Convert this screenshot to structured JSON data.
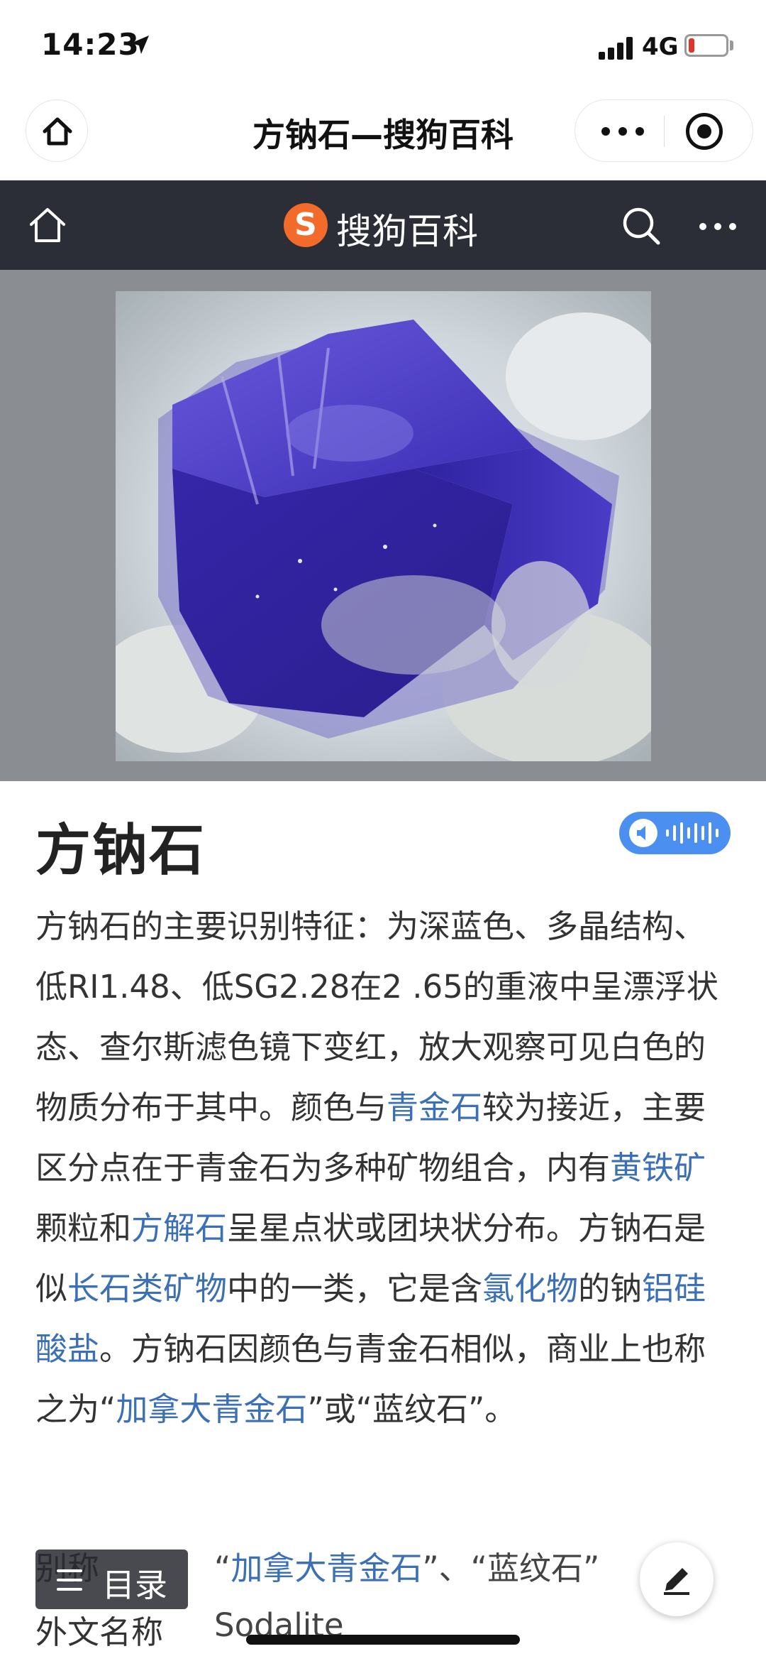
{
  "status_bar": {
    "time": "14:23",
    "network": "4G",
    "battery_level": 0.15,
    "battery_color": "#e0352b"
  },
  "wx_bar": {
    "title": "方钠石—搜狗百科",
    "home_icon": "home-icon",
    "more_icon": "more-dots-icon",
    "close_icon": "close-circle-icon"
  },
  "site_header": {
    "logo_badge": "S",
    "logo_text": "搜狗百科",
    "brand_color": "#f26b2a",
    "background": "#2b2e36",
    "icons": [
      "home-icon",
      "search-icon",
      "more-dots-icon"
    ]
  },
  "hero": {
    "image_subject": "blue sodalite crystal photo"
  },
  "article": {
    "title": "方钠石",
    "body": [
      {
        "text": "方钠石的主要识别特征：为深蓝色、多晶结构、低RI1.48、低SG2.28在2 .65的重液中呈漂浮状态、查尔斯滤色镜下变红，放大观察可见白色的物质分布于其中。颜色与"
      },
      {
        "text": "青金石",
        "link": true
      },
      {
        "text": "较为接近，主要区分点在于青金石为多种矿物组合，内有"
      },
      {
        "text": "黄铁矿",
        "link": true
      },
      {
        "text": "颗粒和"
      },
      {
        "text": "方解石",
        "link": true
      },
      {
        "text": "呈星点状或团块状分布。方钠石是似"
      },
      {
        "text": "长石类矿物",
        "link": true
      },
      {
        "text": "中的一类，它是含"
      },
      {
        "text": "氯化物",
        "link": true
      },
      {
        "text": "的钠"
      },
      {
        "text": "铝硅酸盐",
        "link": true
      },
      {
        "text": "。方钠石因颜色与青金石相似，商业上也称之为“"
      },
      {
        "text": "加拿大青金石",
        "link": true
      },
      {
        "text": "”或“蓝纹石”。"
      }
    ],
    "link_color": "#3b6fb6"
  },
  "info": {
    "alias_label": "别称",
    "alias_quote_open": "“",
    "alias_link": "加拿大青金石",
    "alias_rest": "”、“蓝纹石”",
    "foreign_label": "外文名称",
    "foreign_value": "Sodalite"
  },
  "toc_button": {
    "label": "目录"
  },
  "edit_button": {
    "icon": "pencil-icon"
  }
}
